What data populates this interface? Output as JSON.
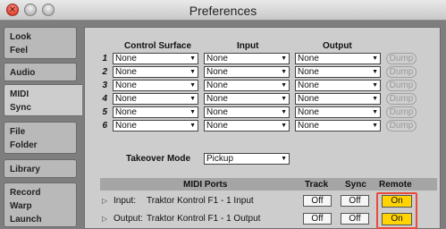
{
  "window": {
    "title": "Preferences"
  },
  "sidebar": {
    "groups": [
      {
        "items": [
          "Look",
          "Feel"
        ]
      },
      {
        "items": [
          "Audio"
        ]
      },
      {
        "items": [
          "MIDI",
          "Sync"
        ]
      },
      {
        "items": [
          "File",
          "Folder"
        ]
      },
      {
        "items": [
          "Library"
        ]
      },
      {
        "items": [
          "Record",
          "Warp",
          "Launch"
        ]
      }
    ],
    "active": "MIDI"
  },
  "control_surfaces": {
    "headers": {
      "surface": "Control Surface",
      "input": "Input",
      "output": "Output"
    },
    "rows": [
      {
        "num": "1",
        "surface": "None",
        "input": "None",
        "output": "None",
        "dump": "Dump"
      },
      {
        "num": "2",
        "surface": "None",
        "input": "None",
        "output": "None",
        "dump": "Dump"
      },
      {
        "num": "3",
        "surface": "None",
        "input": "None",
        "output": "None",
        "dump": "Dump"
      },
      {
        "num": "4",
        "surface": "None",
        "input": "None",
        "output": "None",
        "dump": "Dump"
      },
      {
        "num": "5",
        "surface": "None",
        "input": "None",
        "output": "None",
        "dump": "Dump"
      },
      {
        "num": "6",
        "surface": "None",
        "input": "None",
        "output": "None",
        "dump": "Dump"
      }
    ]
  },
  "takeover": {
    "label": "Takeover Mode",
    "value": "Pickup"
  },
  "midi_ports": {
    "headers": {
      "ports": "MIDI Ports",
      "track": "Track",
      "sync": "Sync",
      "remote": "Remote"
    },
    "rows": [
      {
        "direction": "Input:",
        "name": "Traktor Kontrol F1 - 1 Input",
        "track": "Off",
        "sync": "Off",
        "remote": "On"
      },
      {
        "direction": "Output:",
        "name": "Traktor Kontrol F1 - 1 Output",
        "track": "Off",
        "sync": "Off",
        "remote": "On"
      }
    ]
  },
  "colors": {
    "remote_on": "#ffd400",
    "highlight": "#e94b3c"
  }
}
